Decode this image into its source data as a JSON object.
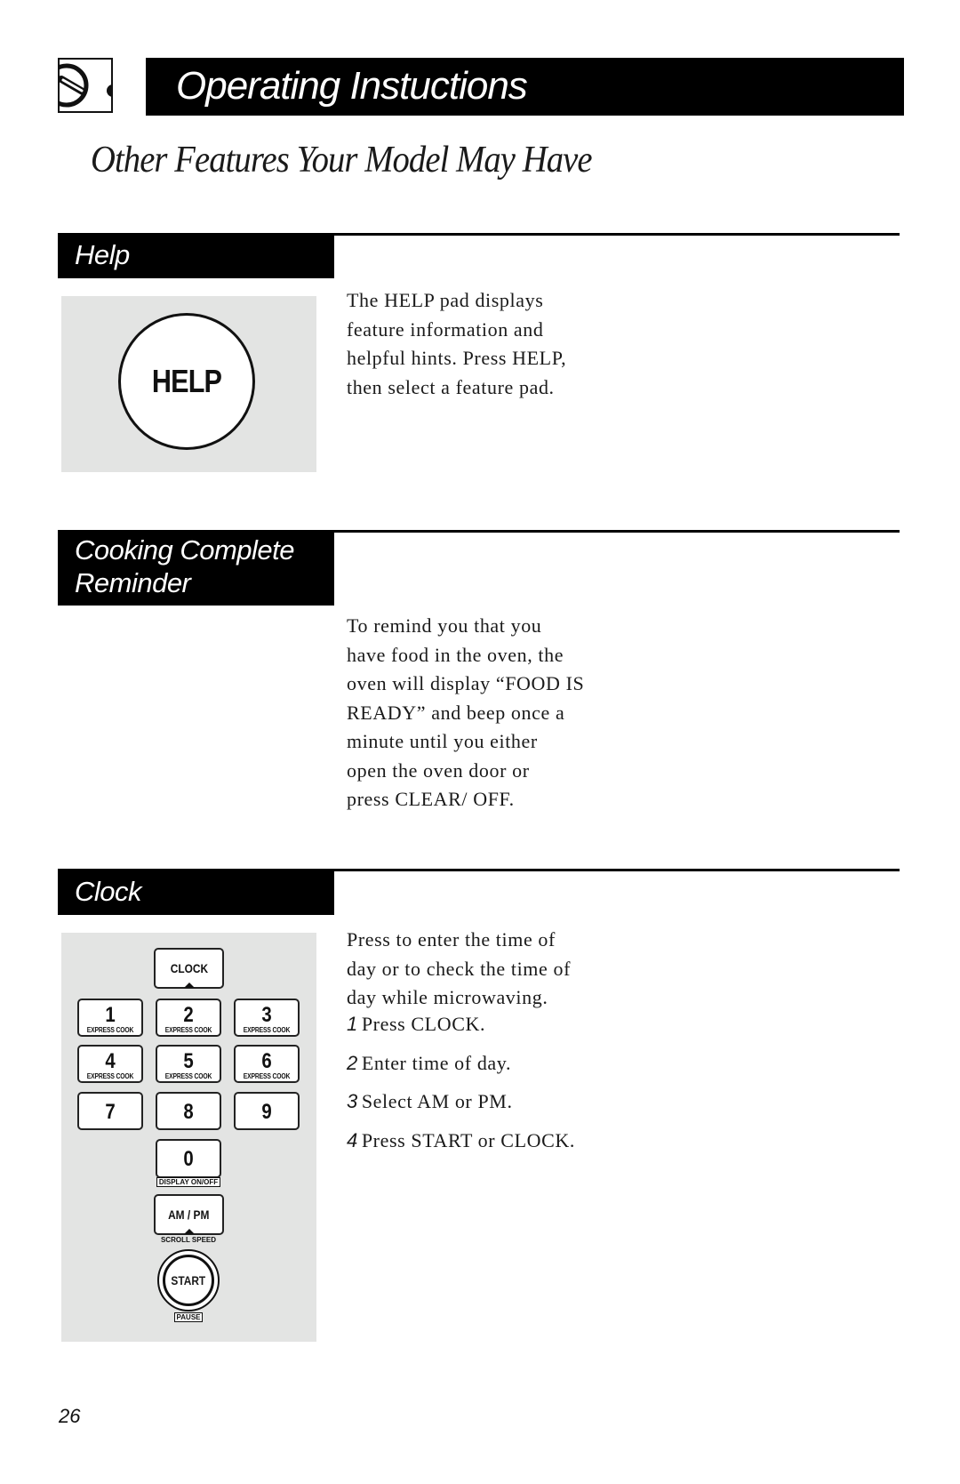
{
  "header": {
    "logo_icon": "dial-knob-icon",
    "title": "Operating Instuctions",
    "subtitle": "Other Features Your Model May Have"
  },
  "sections": [
    {
      "id": "help",
      "heading": "Help",
      "illustration": {
        "button_label": "HELP"
      },
      "body": [
        "The HELP pad displays",
        "feature information and",
        "helpful hints. Press HELP,",
        "then select a feature pad."
      ]
    },
    {
      "id": "cooking-complete-reminder",
      "heading_lines": [
        "Cooking Complete",
        "Reminder"
      ],
      "body": [
        "To remind you that you",
        "have food in the oven, the",
        "oven will display “FOOD IS",
        "READY” and beep once a",
        "minute until you either",
        "open the oven door or",
        "press CLEAR/ OFF."
      ]
    },
    {
      "id": "clock",
      "heading": "Clock",
      "body": [
        "Press to enter the time of",
        "day or to check the time of",
        "day while microwaving."
      ],
      "steps": [
        {
          "num": "1",
          "text": "Press CLOCK."
        },
        {
          "num": "2",
          "text": "Enter time of day."
        },
        {
          "num": "3",
          "text": "Select AM or PM."
        },
        {
          "num": "4",
          "text": "Press START or CLOCK."
        }
      ],
      "keypad": {
        "clock": "CLOCK",
        "digits": [
          {
            "num": "1",
            "sub": "EXPRESS COOK"
          },
          {
            "num": "2",
            "sub": "EXPRESS COOK"
          },
          {
            "num": "3",
            "sub": "EXPRESS COOK"
          },
          {
            "num": "4",
            "sub": "EXPRESS COOK"
          },
          {
            "num": "5",
            "sub": "EXPRESS COOK"
          },
          {
            "num": "6",
            "sub": "EXPRESS COOK"
          },
          {
            "num": "7",
            "sub": ""
          },
          {
            "num": "8",
            "sub": ""
          },
          {
            "num": "9",
            "sub": ""
          }
        ],
        "zero": "0",
        "zero_caption": "DISPLAY ON/OFF",
        "ampm": "AM / PM",
        "ampm_caption": "SCROLL SPEED",
        "start": "START",
        "start_caption": "PAUSE"
      }
    }
  ],
  "footer": {
    "page_number": "26"
  },
  "colors": {
    "ink": "#000000",
    "panel_gray": "#e3e4e3",
    "page": "#ffffff"
  }
}
